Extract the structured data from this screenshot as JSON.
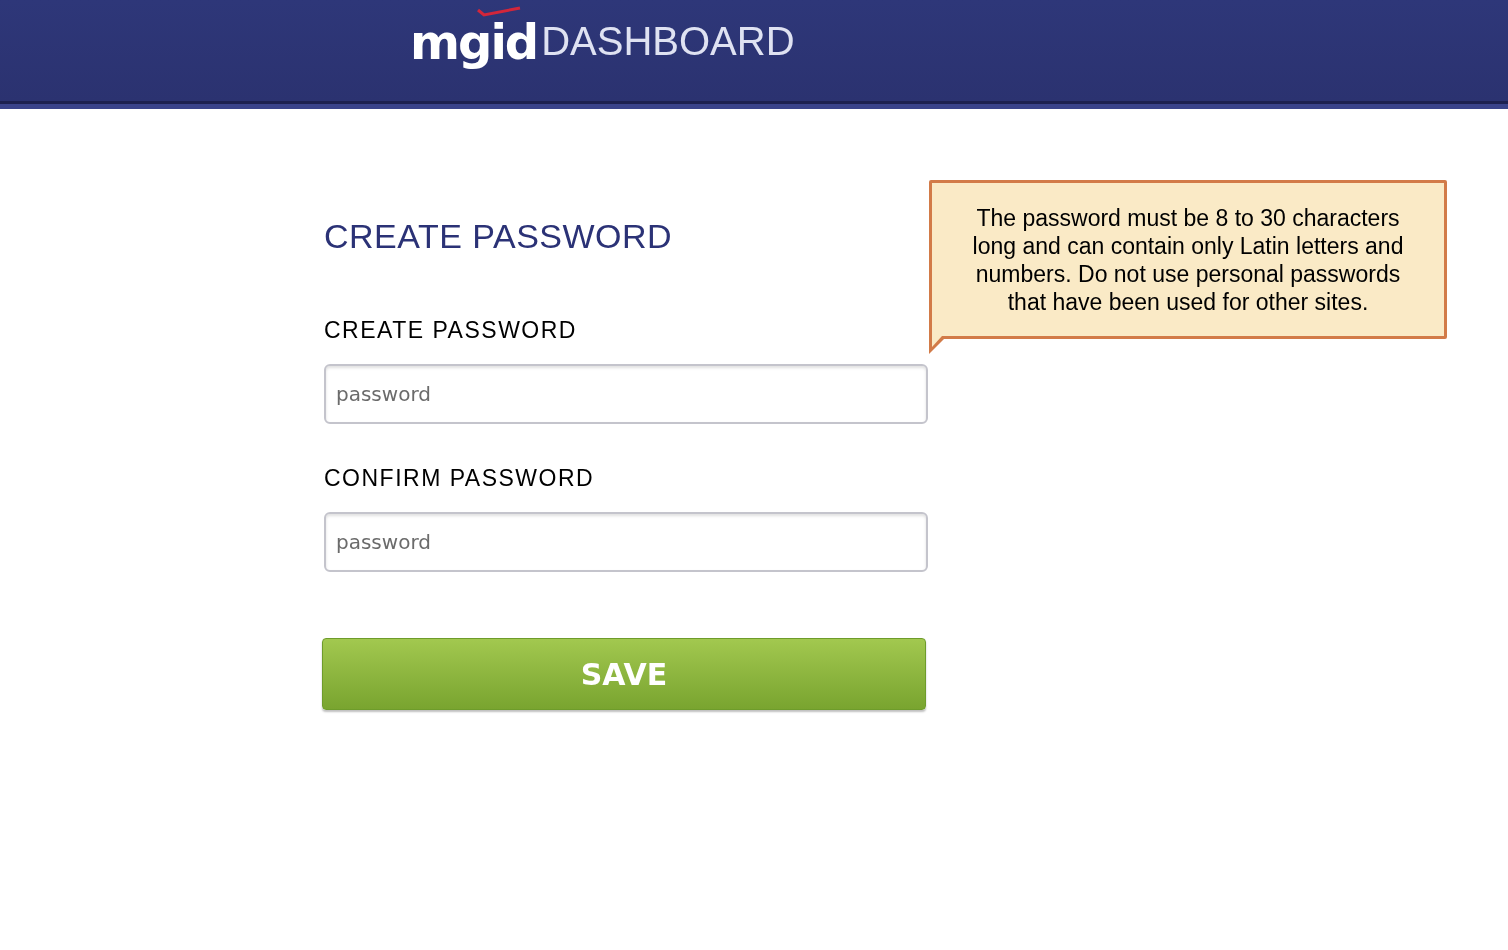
{
  "header": {
    "logo_mark": "mgid",
    "logo_text": "DASHBOARD"
  },
  "form": {
    "title": "CREATE PASSWORD",
    "fields": [
      {
        "label": "CREATE PASSWORD",
        "placeholder": "password"
      },
      {
        "label": "CONFIRM PASSWORD",
        "placeholder": "password"
      }
    ],
    "button": "SAVE"
  },
  "tooltip": "The password must be 8 to 30 characters long and can contain only Latin letters and numbers. Do not use personal passwords that have been used for other sites."
}
